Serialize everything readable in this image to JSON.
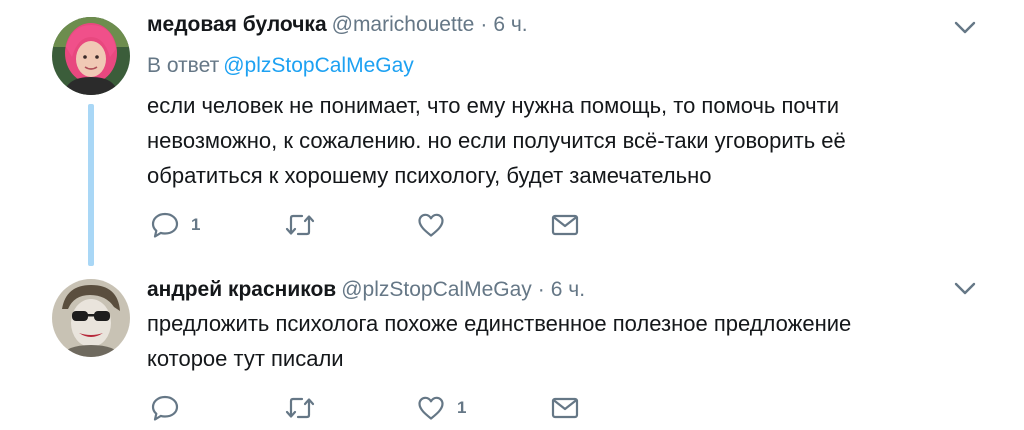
{
  "tweets": [
    {
      "display_name": "медовая булочка",
      "handle": "@marichouette",
      "separator": "·",
      "time": "6 ч.",
      "reply_to_label": "В ответ",
      "reply_to_handle": "@plzStopCalMeGay",
      "text_lines": [
        "если человек не понимает, что ему нужна помощь, то помочь почти",
        "невозможно, к сожалению. но если получится всё-таки уговорить её",
        "обратиться к хорошему психологу, будет замечательно"
      ],
      "reply_count": "1",
      "retweet_count": "",
      "like_count": "",
      "avatar_icon": "avatar-pink-hair",
      "accent_color": "#f0508a"
    },
    {
      "display_name": "андрей красников",
      "handle": "@plzStopCalMeGay",
      "separator": "·",
      "time": "6 ч.",
      "text_lines": [
        "предложить психолога похоже единственное полезное предложение",
        "которое тут писали"
      ],
      "reply_count": "",
      "retweet_count": "",
      "like_count": "1",
      "avatar_icon": "avatar-sunglasses"
    }
  ],
  "icons": {
    "reply": "speech-bubble-icon",
    "retweet": "retweet-arrows-icon",
    "like": "heart-outline-icon",
    "dm": "envelope-icon",
    "caret": "chevron-down-icon"
  },
  "colors": {
    "text": "#14171a",
    "secondary": "#657786",
    "link": "#1da1f2",
    "thread_line": "#a9d7f6"
  }
}
